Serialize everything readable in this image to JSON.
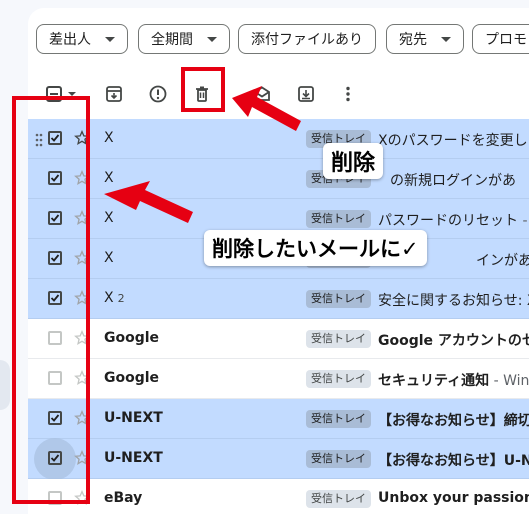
{
  "filters": [
    {
      "label": "差出人",
      "dropdown": true
    },
    {
      "label": "全期間",
      "dropdown": true
    },
    {
      "label": "添付ファイルあり",
      "dropdown": false
    },
    {
      "label": "宛先",
      "dropdown": true
    },
    {
      "label": "プロモ",
      "dropdown": false
    }
  ],
  "inbox_label": "受信トレイ",
  "emails": [
    {
      "sender": "X",
      "count": "",
      "subject": "Xのパスワードを変更し",
      "snippet": "",
      "selected": true,
      "unread": false
    },
    {
      "sender": "X",
      "count": "",
      "subject": "の新規ログインがあ",
      "snippet": "",
      "selected": true,
      "unread": false
    },
    {
      "sender": "X",
      "count": "",
      "subject": "パスワードのリセット",
      "snippet": " -",
      "selected": true,
      "unread": false
    },
    {
      "sender": "X",
      "count": "",
      "subject": "インがあ",
      "snippet": "",
      "selected": true,
      "unread": false
    },
    {
      "sender": "X",
      "count": "2",
      "subject": "安全に関するお知らせ: X",
      "snippet": "",
      "selected": true,
      "unread": false
    },
    {
      "sender": "Google",
      "count": "",
      "subject": "Google アカウントのセ",
      "snippet": "",
      "selected": false,
      "unread": true
    },
    {
      "sender": "Google",
      "count": "",
      "subject": "セキュリティ通知",
      "snippet": " - Wind",
      "selected": false,
      "unread": true
    },
    {
      "sender": "U-NEXT",
      "count": "",
      "subject": "【お得なお知らせ】締切",
      "snippet": "",
      "selected": true,
      "unread": true
    },
    {
      "sender": "U-NEXT",
      "count": "",
      "subject": "【お得なお知らせ】U-N",
      "snippet": "",
      "selected": true,
      "unread": true
    },
    {
      "sender": "eBay",
      "count": "",
      "subject": "Unbox your passion fo",
      "snippet": "",
      "selected": false,
      "unread": true
    }
  ],
  "annotations": {
    "delete_label": "削除",
    "select_label": "削除したいメールに✓",
    "color": "#e60012"
  }
}
